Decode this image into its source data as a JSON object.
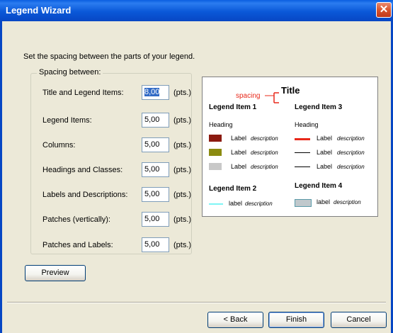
{
  "window": {
    "title": "Legend Wizard",
    "close_glyph": "✕"
  },
  "instruction": "Set the spacing between the parts of your legend.",
  "group": {
    "label": "Spacing between:",
    "rows": [
      {
        "label": "Title and Legend Items:",
        "value": "8,00",
        "unit": "(pts.)"
      },
      {
        "label": "Legend Items:",
        "value": "5,00",
        "unit": "(pts.)"
      },
      {
        "label": "Columns:",
        "value": "5,00",
        "unit": "(pts.)"
      },
      {
        "label": "Headings and Classes:",
        "value": "5,00",
        "unit": "(pts.)"
      },
      {
        "label": "Labels and Descriptions:",
        "value": "5,00",
        "unit": "(pts.)"
      },
      {
        "label": "Patches (vertically):",
        "value": "5,00",
        "unit": "(pts.)"
      },
      {
        "label": "Patches and Labels:",
        "value": "5,00",
        "unit": "(pts.)"
      }
    ]
  },
  "preview_panel": {
    "title": "Title",
    "spacing_label": "spacing",
    "item1": {
      "name": "Legend Item 1",
      "heading": "Heading",
      "rows": [
        {
          "label": "Label",
          "desc": "description",
          "color": "#8b1a10"
        },
        {
          "label": "Label",
          "desc": "description",
          "color": "#8b8b10"
        },
        {
          "label": "Label",
          "desc": "description",
          "color": "#c8c8c8"
        }
      ]
    },
    "item2": {
      "name": "Legend Item 2",
      "label": "label",
      "desc": "description",
      "color": "#7ff5f5"
    },
    "item3": {
      "name": "Legend Item 3",
      "heading": "Heading",
      "rows": [
        {
          "label": "Label",
          "desc": "description",
          "color": "#e8281a"
        },
        {
          "label": "Label",
          "desc": "description",
          "color": "#000000"
        },
        {
          "label": "Label",
          "desc": "description",
          "color": "#000000"
        }
      ]
    },
    "item4": {
      "name": "Legend Item 4",
      "label": "label",
      "desc": "description",
      "color": "#c0c8cc"
    },
    "accent_color": "#e8281a"
  },
  "buttons": {
    "preview": "Preview",
    "back": "< Back",
    "finish": "Finish",
    "cancel": "Cancel"
  }
}
